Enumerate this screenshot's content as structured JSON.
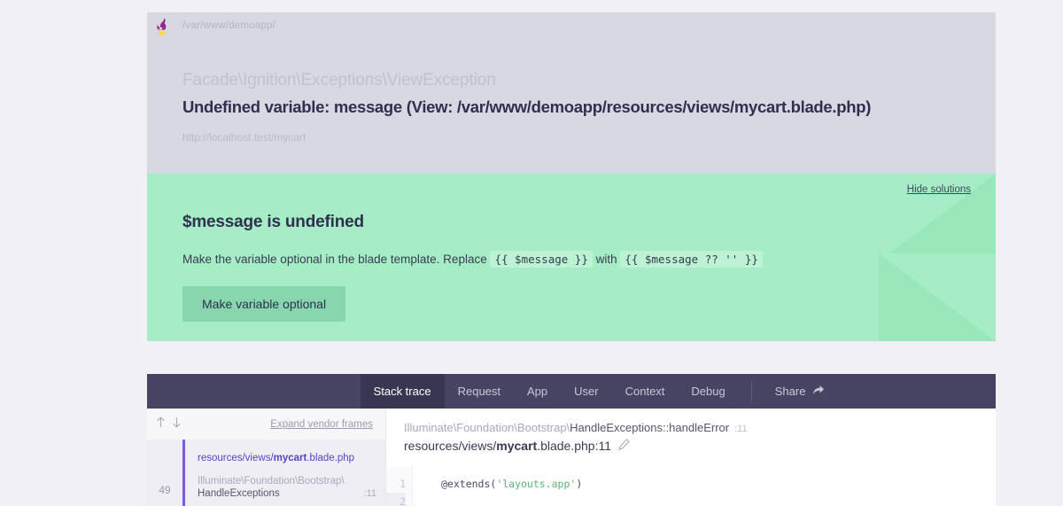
{
  "error_card": {
    "logo_name": "ignition-flare-logo",
    "breadcrumb_path": "/var/www/demoapp/",
    "exception_class": "Facade\\Ignition\\Exceptions\\ViewException",
    "exception_message": "Undefined variable: message (View: /var/www/demoapp/resources/views/mycart.blade.php)",
    "request_url": "http://localhost.test/mycart",
    "bg_color": "#d8d8e3"
  },
  "solution": {
    "hide_link": "Hide solutions",
    "title": "$message is undefined",
    "desc_prefix": "Make the variable optional in the blade template. Replace",
    "code_before": "{{ $message }}",
    "desc_middle": "with",
    "code_after": "{{ $message ?? '' }}",
    "button_label": "Make variable optional",
    "bg_color": "#a5edc4",
    "accent_color": "#9ae7bb"
  },
  "tabs": {
    "items": [
      {
        "label": "Stack trace",
        "active": true
      },
      {
        "label": "Request",
        "active": false
      },
      {
        "label": "App",
        "active": false
      },
      {
        "label": "User",
        "active": false
      },
      {
        "label": "Context",
        "active": false
      },
      {
        "label": "Debug",
        "active": false
      }
    ],
    "share_label": "Share",
    "share_icon": "share-arrow-icon",
    "bg_color": "#474463",
    "active_bg_color": "#393651"
  },
  "stack_trace": {
    "sort_up_icon": "arrow-up-icon",
    "sort_down_icon": "arrow-down-icon",
    "expand_vendor_label": "Expand vendor frames",
    "frames": [
      {
        "number": "49",
        "file_dir": "resources/views/",
        "file_name_bold": "mycart",
        "file_name_rest": ".blade.php",
        "class_line1": "Illuminate\\Foundation\\Bootstrap\\",
        "class_line2": "HandleExceptions",
        "line": ":11",
        "selected": true
      }
    ]
  },
  "code_panel": {
    "header_class_prefix": "Illuminate\\Foundation\\Bootstrap\\",
    "header_class_bold": "HandleExceptions::handleError",
    "header_class_line": ":11",
    "header_file_dir": "resources/views/",
    "header_file_bold": "mycart",
    "header_file_rest": ".blade.php:11",
    "edit_icon": "pencil-icon",
    "lines": [
      {
        "num": "1",
        "code": "@extends(",
        "string": "'layouts.app'",
        "suffix": ")",
        "highlight": false
      },
      {
        "num": "2",
        "code": "",
        "string": "",
        "suffix": "",
        "highlight": true
      }
    ]
  }
}
